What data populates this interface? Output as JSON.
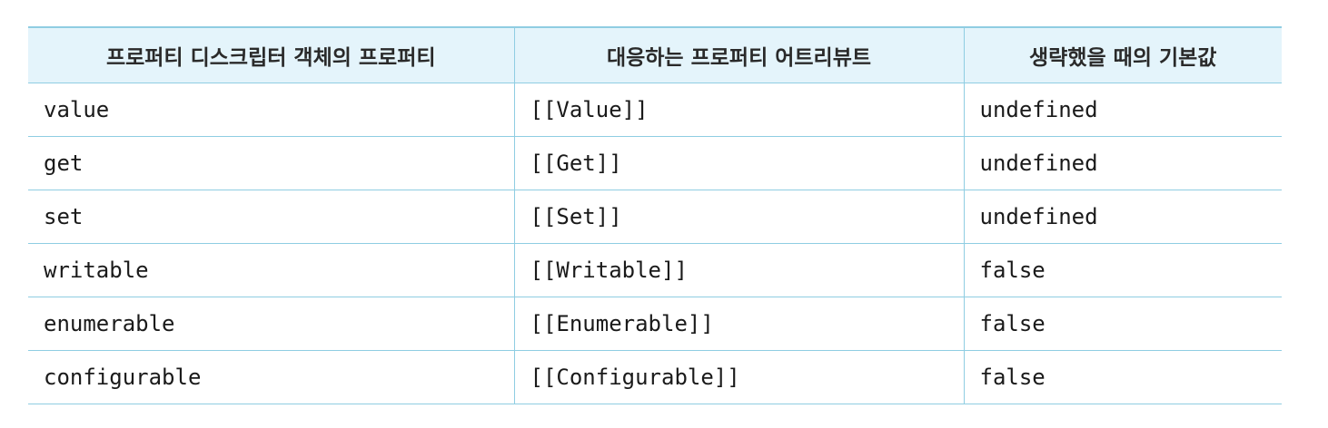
{
  "table": {
    "headers": [
      "프로퍼티 디스크립터 객체의 프로퍼티",
      "대응하는 프로퍼티 어트리뷰트",
      "생략했을 때의 기본값"
    ],
    "rows": [
      [
        "value",
        "[[Value]]",
        "undefined"
      ],
      [
        "get",
        "[[Get]]",
        "undefined"
      ],
      [
        "set",
        "[[Set]]",
        "undefined"
      ],
      [
        "writable",
        "[[Writable]]",
        "false"
      ],
      [
        "enumerable",
        "[[Enumerable]]",
        "false"
      ],
      [
        "configurable",
        "[[Configurable]]",
        "false"
      ]
    ]
  },
  "colors": {
    "header_bg": "#e4f4fb",
    "border": "#8fcde2",
    "text": "#1a1a1a"
  }
}
